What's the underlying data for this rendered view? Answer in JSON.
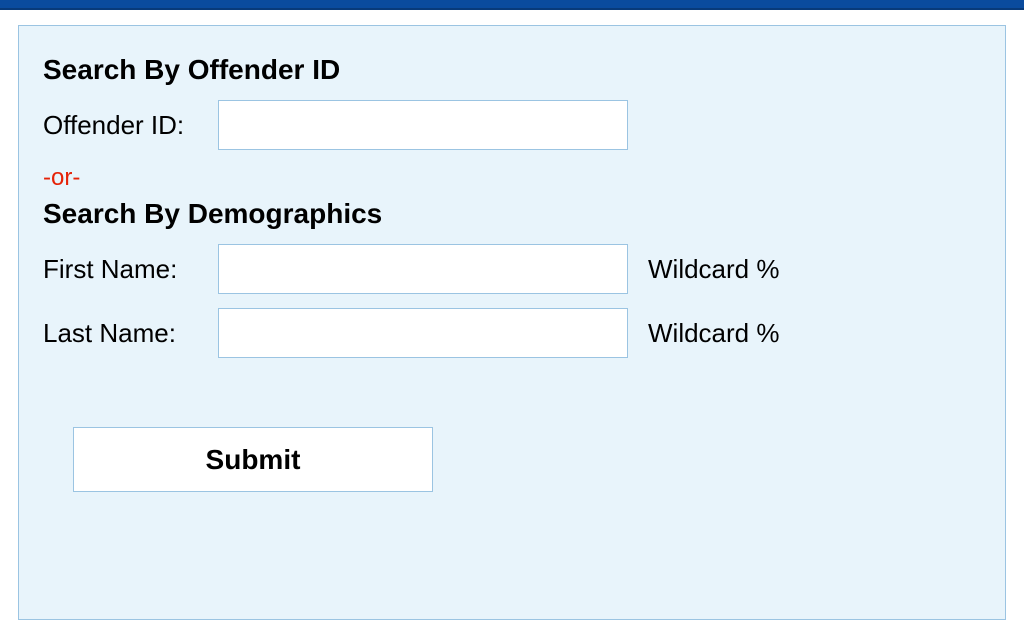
{
  "section1": {
    "heading": "Search By Offender ID",
    "offender_id_label": "Offender ID:",
    "offender_id_value": ""
  },
  "separator": "-or-",
  "section2": {
    "heading": "Search By Demographics",
    "first_name_label": "First Name:",
    "first_name_value": "",
    "first_name_hint": "Wildcard %",
    "last_name_label": "Last Name:",
    "last_name_value": "",
    "last_name_hint": "Wildcard %"
  },
  "submit_label": "Submit"
}
